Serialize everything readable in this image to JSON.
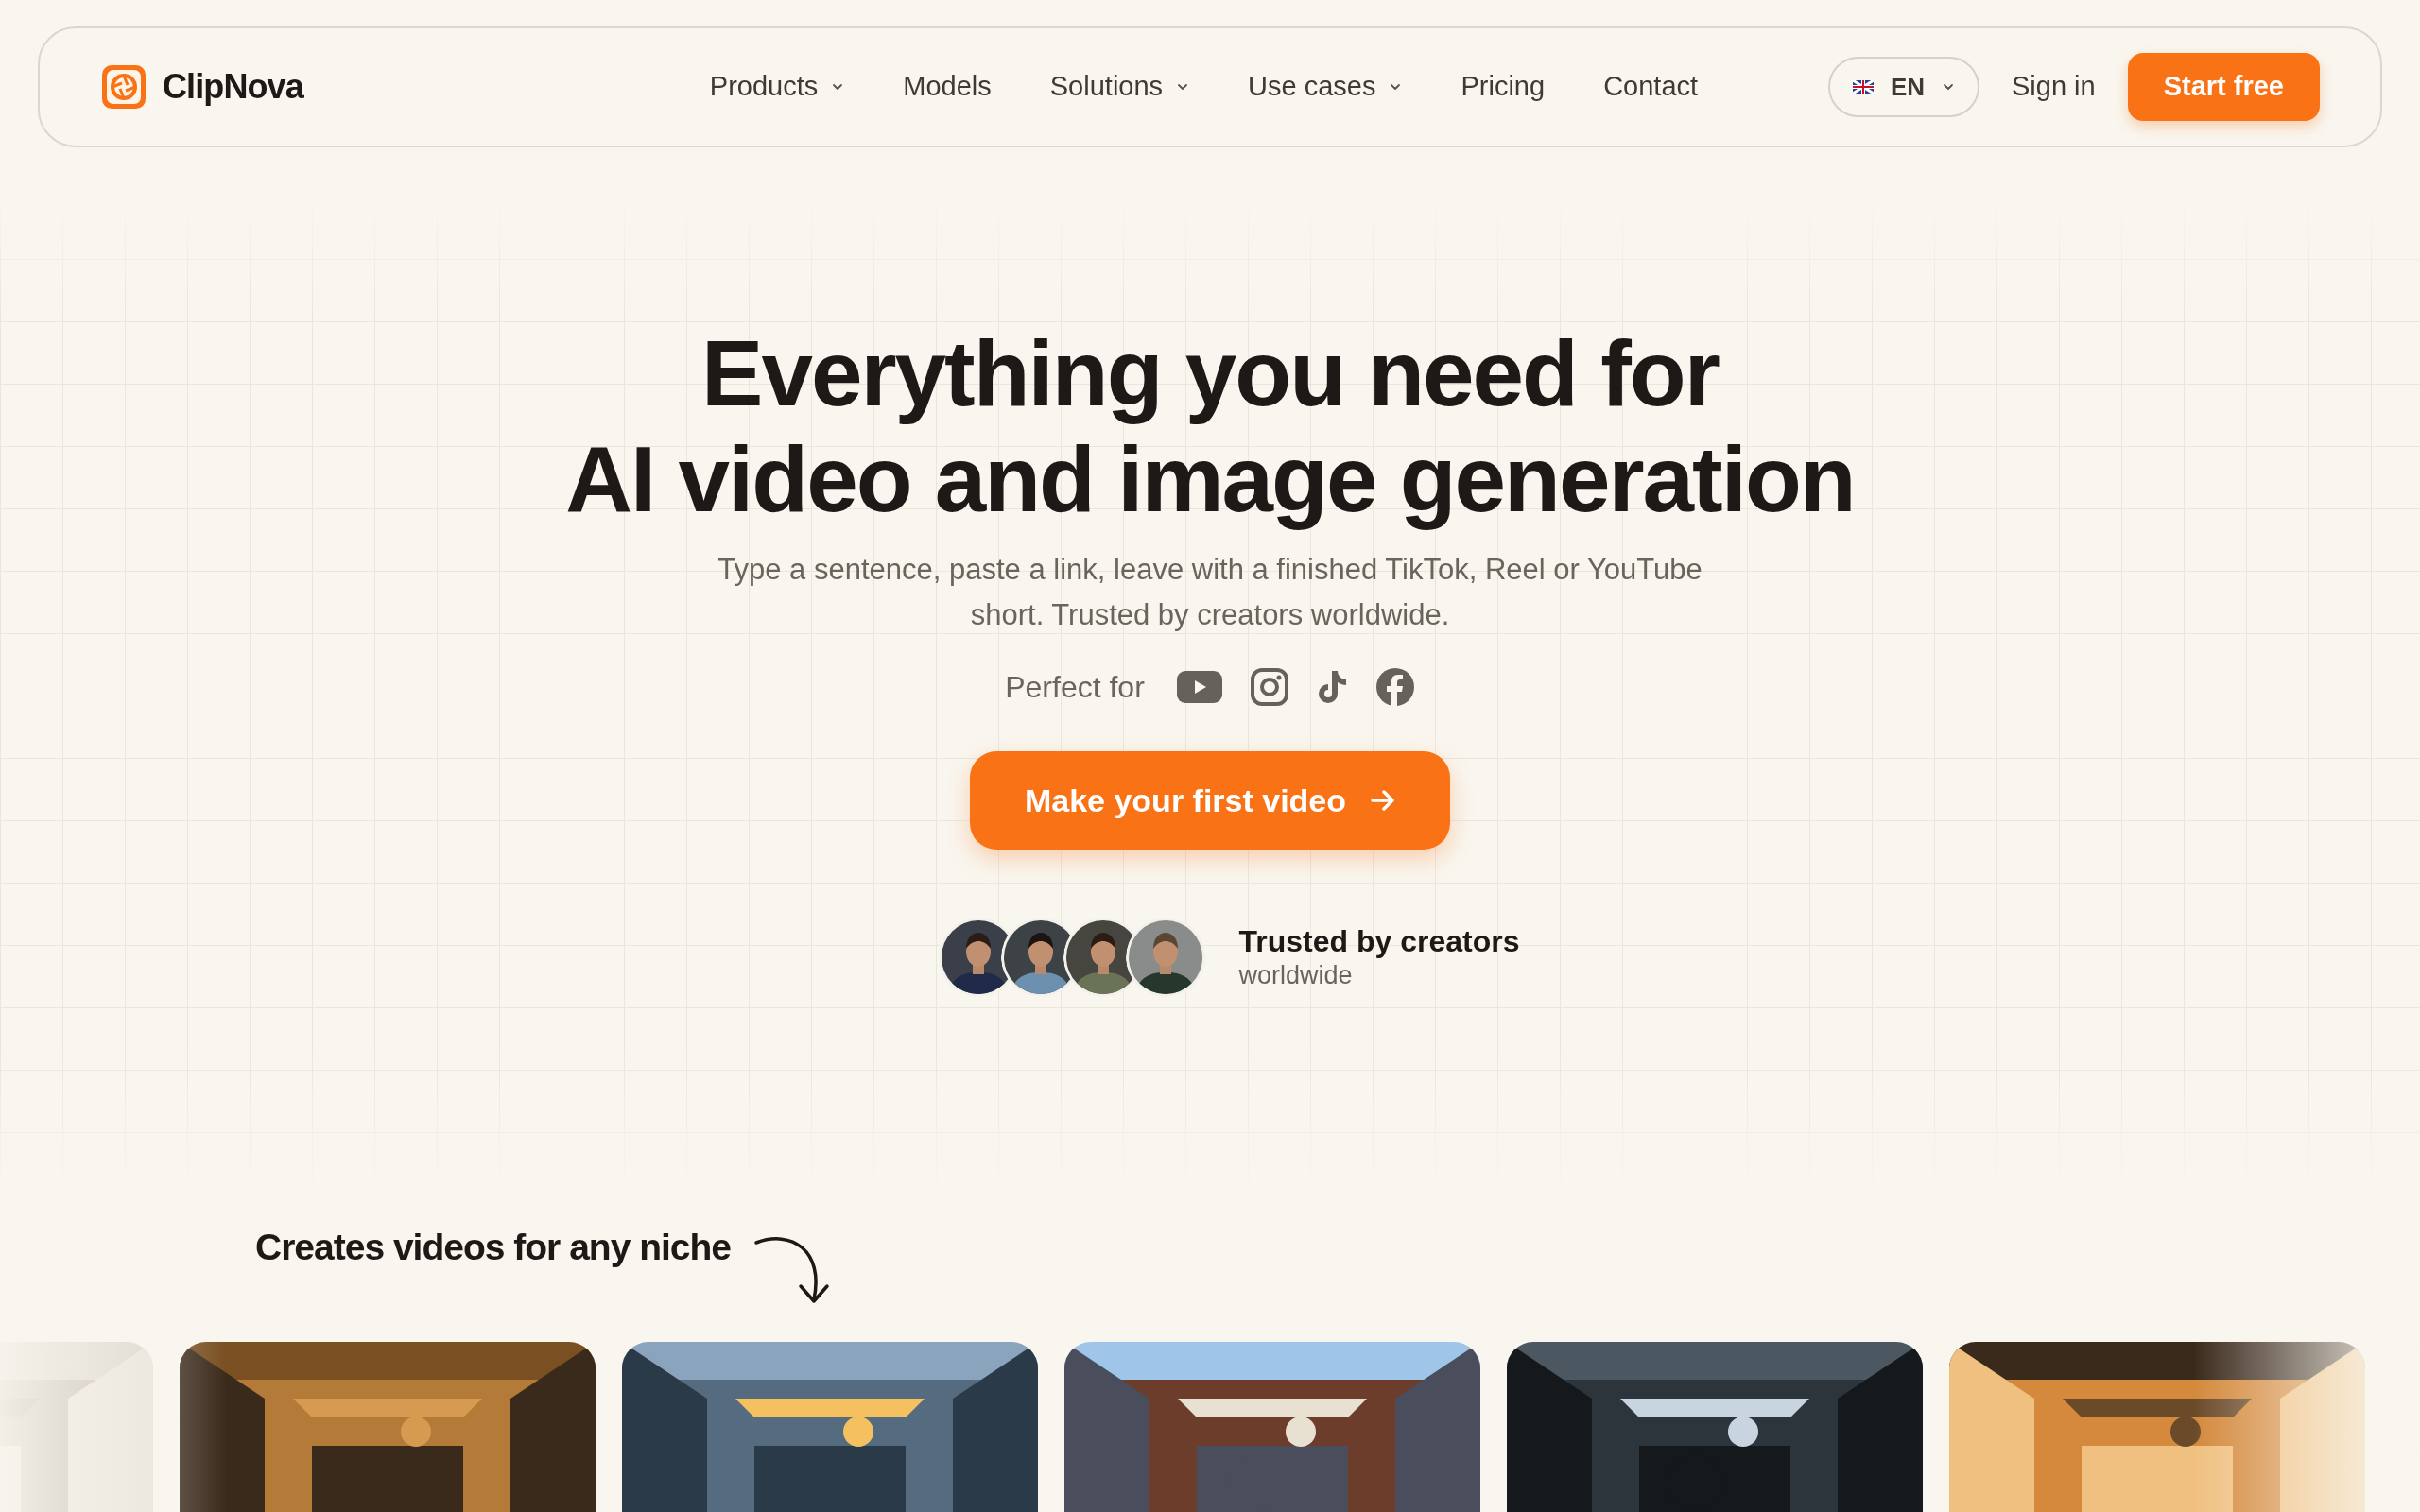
{
  "brand": {
    "name": "ClipNova"
  },
  "nav": {
    "items": [
      {
        "label": "Products",
        "dropdown": true
      },
      {
        "label": "Models",
        "dropdown": false
      },
      {
        "label": "Solutions",
        "dropdown": true
      },
      {
        "label": "Use cases",
        "dropdown": true
      },
      {
        "label": "Pricing",
        "dropdown": false
      },
      {
        "label": "Contact",
        "dropdown": false
      }
    ],
    "language": "EN",
    "sign_in": "Sign in",
    "cta": "Start free"
  },
  "hero": {
    "title_lines": [
      "Everything you need for",
      "AI video and image generation"
    ],
    "subtitle": "Type a sentence, paste a link, leave with a finished TikTok, Reel or YouTube short. Trusted by creators worldwide.",
    "perfect_for": "Perfect for",
    "platforms": [
      {
        "kind": "youtube"
      },
      {
        "kind": "instagram"
      },
      {
        "kind": "tiktok"
      },
      {
        "kind": "facebook"
      }
    ],
    "button": "Make your first video",
    "trust_title": "Trusted by creators",
    "trust_subtitle": "worldwide"
  },
  "niche": {
    "title": "Creates videos for any niche"
  }
}
